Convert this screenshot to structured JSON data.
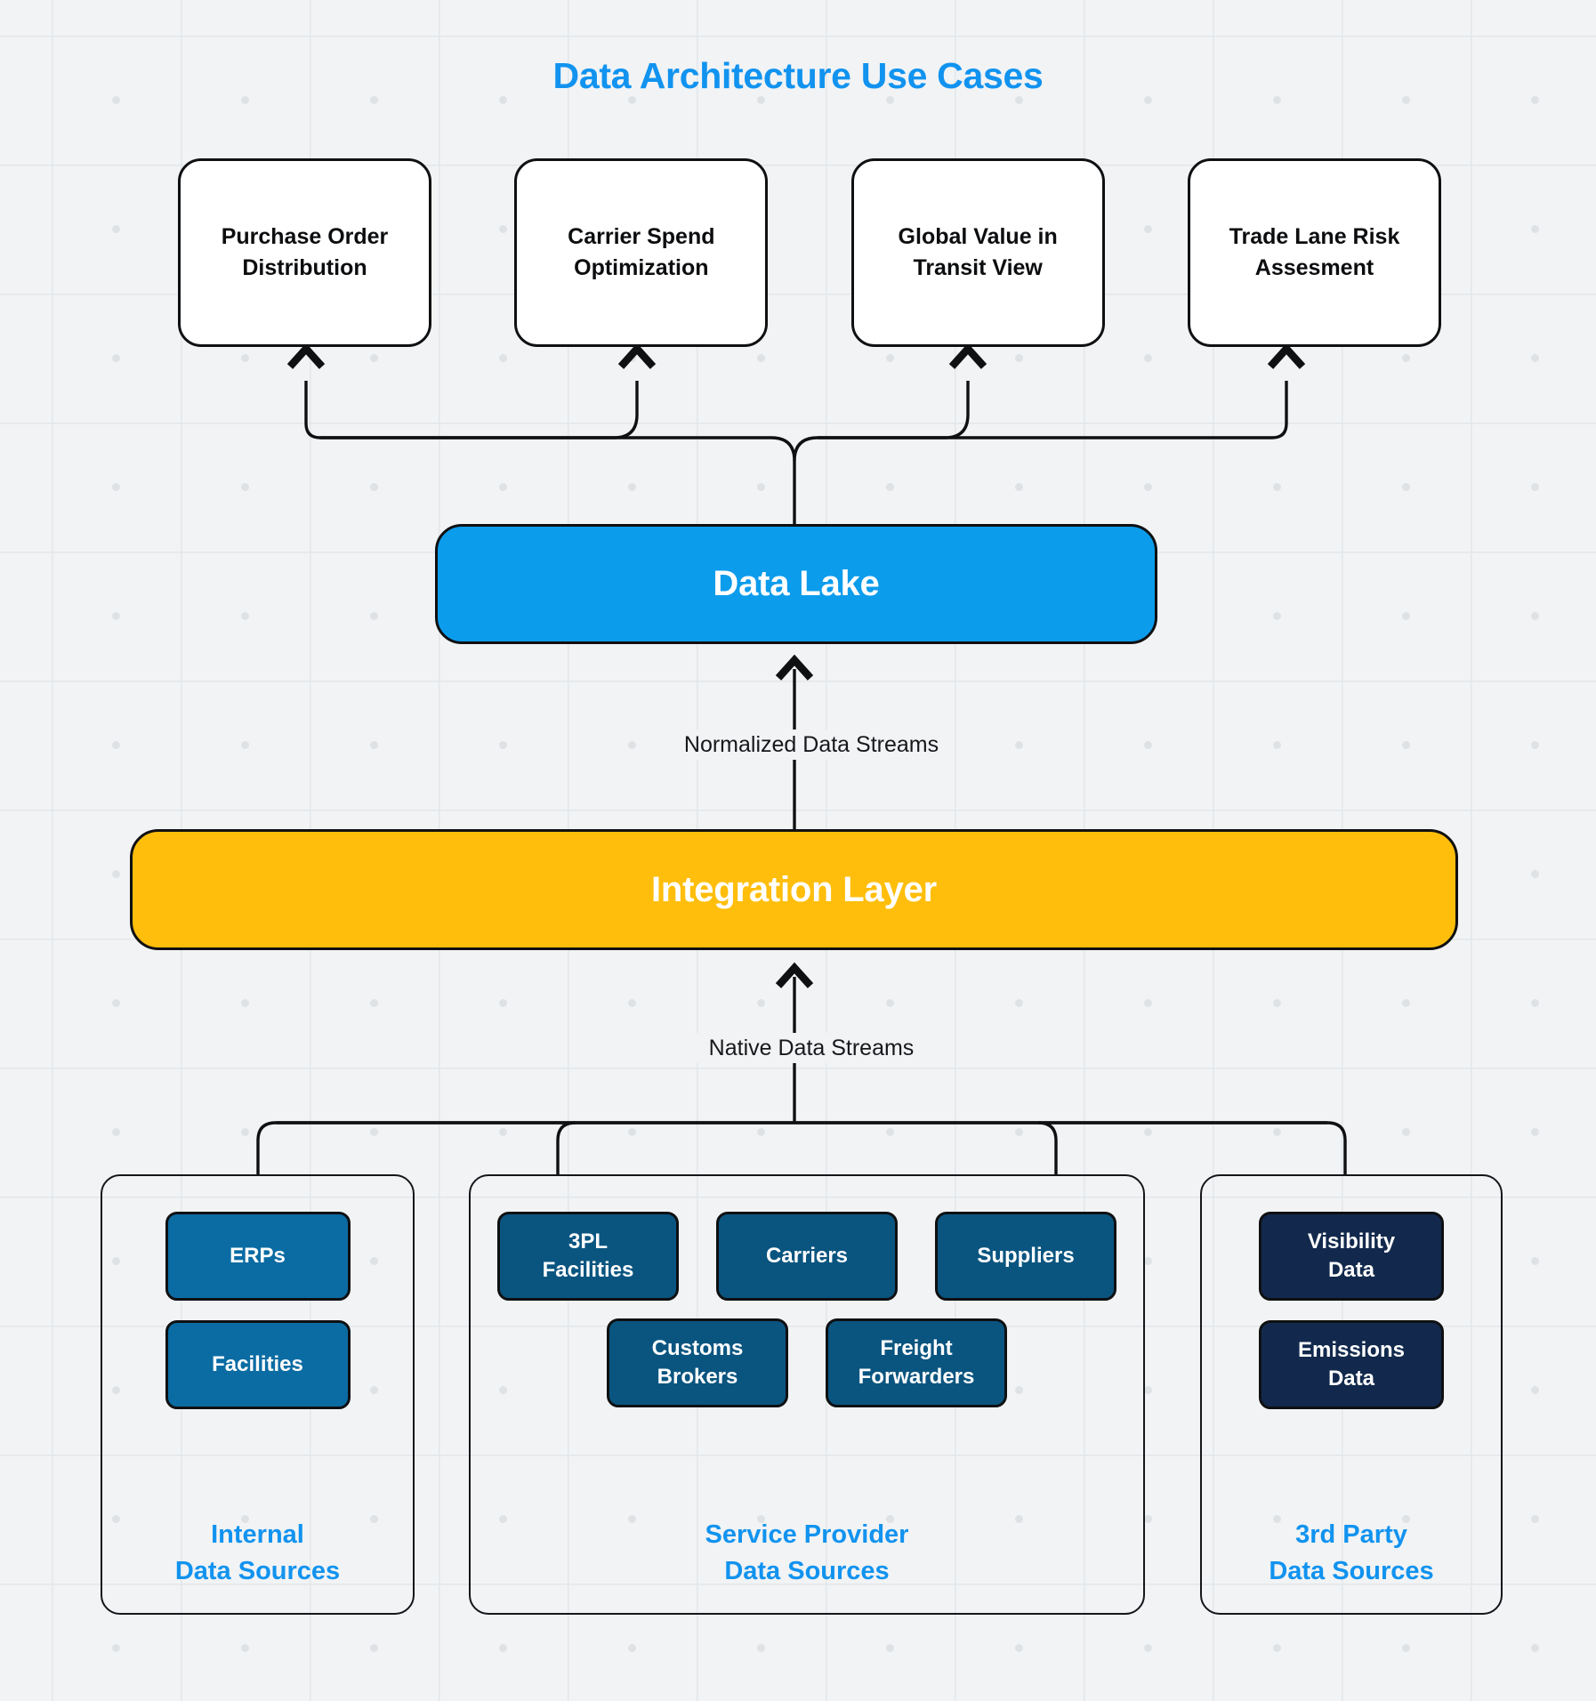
{
  "title": "Data Architecture Use Cases",
  "colors": {
    "background": "#f1f3f5",
    "grid_line": "#e4e7e9",
    "grid_dot": "#dfe2e5",
    "accent_blue": "#1193ef",
    "data_lake": "#0c9cec",
    "integration_layer": "#ffbe0b",
    "internal_chip": "#0b6ca3",
    "service_chip": "#0a5580",
    "thirdparty_chip": "#12294d",
    "stroke": "#0f1012",
    "box_white": "#ffffff"
  },
  "use_cases": [
    {
      "label": "Purchase Order Distribution"
    },
    {
      "label": "Carrier Spend Optimization"
    },
    {
      "label": "Global Value in Transit View"
    },
    {
      "label": "Trade Lane Risk Assesment"
    }
  ],
  "data_lake": {
    "label": "Data Lake"
  },
  "integration_layer": {
    "label": "Integration Layer"
  },
  "streams": {
    "normalized": "Normalized Data Streams",
    "native": "Native Data Streams"
  },
  "source_groups": [
    {
      "id": "internal",
      "label_line1": "Internal",
      "label_line2": "Data Sources",
      "nodes": [
        {
          "label": "ERPs"
        },
        {
          "label": "Facilities"
        }
      ]
    },
    {
      "id": "service",
      "label_line1": "Service Provider",
      "label_line2": "Data Sources",
      "row1": [
        {
          "label_line1": "3PL",
          "label_line2": "Facilities"
        },
        {
          "label_line1": "Carriers",
          "label_line2": ""
        },
        {
          "label_line1": "Suppliers",
          "label_line2": ""
        }
      ],
      "row2": [
        {
          "label_line1": "Customs",
          "label_line2": "Brokers"
        },
        {
          "label_line1": "Freight",
          "label_line2": "Forwarders"
        }
      ]
    },
    {
      "id": "thirdparty",
      "label_line1": "3rd Party",
      "label_line2": "Data Sources",
      "nodes": [
        {
          "label_line1": "Visibility",
          "label_line2": "Data"
        },
        {
          "label_line1": "Emissions",
          "label_line2": "Data"
        }
      ]
    }
  ]
}
